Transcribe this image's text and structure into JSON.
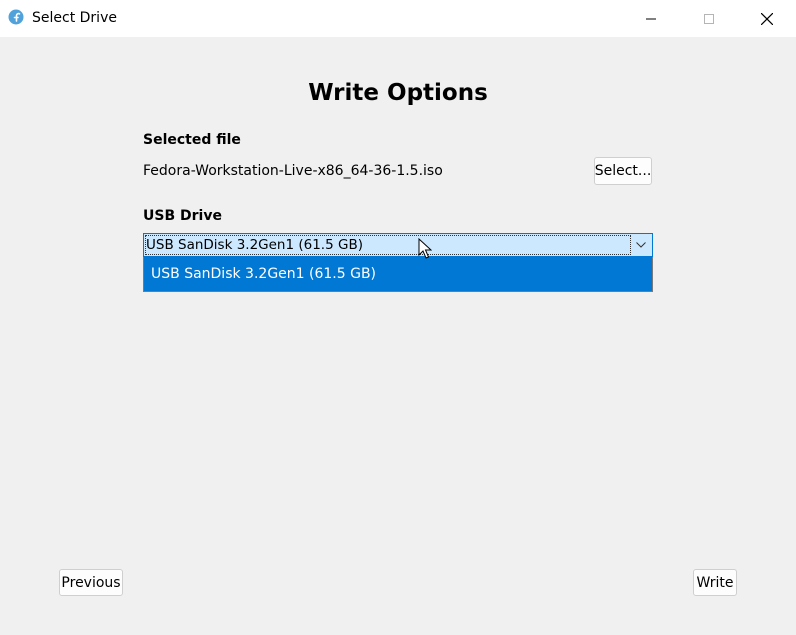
{
  "window": {
    "title": "Select Drive",
    "app_icon": "fedora-icon",
    "controls": [
      "minimize-icon",
      "maximize-icon",
      "close-icon"
    ]
  },
  "main": {
    "heading": "Write Options",
    "selected_file": {
      "label": "Selected file",
      "value": "Fedora-Workstation-Live-x86_64-36-1.5.iso",
      "select_button": "Select..."
    },
    "usb_drive": {
      "label": "USB Drive",
      "selected_value": "USB SanDisk 3.2Gen1 (61.5 GB)",
      "options": [
        "USB SanDisk 3.2Gen1 (61.5 GB)"
      ]
    }
  },
  "footer": {
    "previous_button": "Previous",
    "write_button": "Write"
  },
  "colors": {
    "accent": "#0078d4",
    "combo_highlight": "#cce8ff",
    "background": "#f0f0f0"
  }
}
